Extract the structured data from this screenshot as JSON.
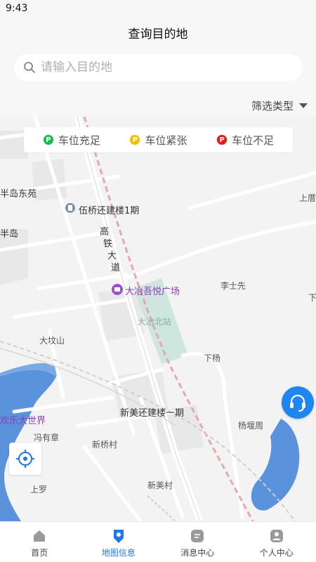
{
  "status_bar": {
    "time": "9:43"
  },
  "header": {
    "title": "查询目的地"
  },
  "search": {
    "placeholder": "请输入目的地"
  },
  "filter": {
    "label": "筛选类型"
  },
  "legend": [
    {
      "label": "车位充足",
      "color": "#1fb84a",
      "symbol": "P"
    },
    {
      "label": "车位紧张",
      "color": "#f0c000",
      "symbol": "P"
    },
    {
      "label": "车位不足",
      "color": "#e61919",
      "symbol": "P"
    }
  ],
  "map": {
    "labels": {
      "bandao_dongyuan": "半岛东苑",
      "wuqiao": "伍桥还建楼1期",
      "bandao": "半岛",
      "gaotie1": "高",
      "gaotie2": "铁",
      "gaotie3": "大",
      "gaotie4": "道",
      "wuyue": "大冶吾悦广场",
      "lishixian": "李士先",
      "daye_north": "大冶北站",
      "dafenshan": "大坟山",
      "xiayang": "下杨",
      "xinmei_hj": "新美还建楼一期",
      "yangyanzhou": "杨堰周",
      "huanle": "欢乐大世界",
      "fengyouzhang": "冯有章",
      "xinqiaocun": "新桥村",
      "shangluo": "上罗",
      "xinmeicun": "新美村",
      "shangmei": "上厝",
      "xia_edge": "下"
    }
  },
  "tabbar": [
    {
      "label": "首页",
      "icon": "home-icon",
      "active": false
    },
    {
      "label": "地图信息",
      "icon": "map-pin-icon",
      "active": true
    },
    {
      "label": "消息中心",
      "icon": "message-icon",
      "active": false
    },
    {
      "label": "个人中心",
      "icon": "user-icon",
      "active": false
    }
  ],
  "colors": {
    "accent": "#1f78e8",
    "service_button": "#1f86f0"
  }
}
